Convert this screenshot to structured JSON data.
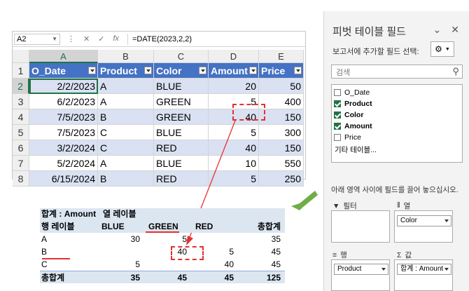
{
  "sheet": {
    "name_box": "A2",
    "formula_icons": [
      "⋮",
      "✕",
      "✓",
      "fx"
    ],
    "formula": "=DATE(2023,2,2)",
    "col_letters": [
      "A",
      "B",
      "C",
      "D",
      "E"
    ],
    "row_numbers": [
      "1",
      "2",
      "3",
      "4",
      "5",
      "6",
      "7",
      "8"
    ],
    "headers": [
      "O_Date",
      "Product",
      "Color",
      "Amount",
      "Price"
    ],
    "rows": [
      [
        "2/2/2023",
        "A",
        "BLUE",
        "20",
        "50"
      ],
      [
        "6/2/2023",
        "A",
        "GREEN",
        "5",
        "400"
      ],
      [
        "7/5/2023",
        "B",
        "GREEN",
        "40",
        "150"
      ],
      [
        "7/5/2023",
        "C",
        "BLUE",
        "5",
        "300"
      ],
      [
        "3/2/2024",
        "C",
        "RED",
        "40",
        "150"
      ],
      [
        "5/2/2024",
        "A",
        "BLUE",
        "10",
        "550"
      ],
      [
        "6/15/2024",
        "B",
        "RED",
        "5",
        "250"
      ]
    ]
  },
  "pivot": {
    "value_label": "합계 : Amount",
    "col_label": "열 레이블",
    "row_label": "행 레이블",
    "columns": [
      "BLUE",
      "GREEN",
      "RED",
      "총합계"
    ],
    "rows": [
      [
        "A",
        "30",
        "5",
        "",
        "35"
      ],
      [
        "B",
        "",
        "40",
        "5",
        "45"
      ],
      [
        "C",
        "5",
        "",
        "40",
        "45"
      ]
    ],
    "total": [
      "총합계",
      "35",
      "45",
      "45",
      "125"
    ]
  },
  "pane": {
    "title": "피벗 테이블 필드",
    "chevron": "⌄",
    "close": "✕",
    "subtitle": "보고서에 추가할 필드 선택:",
    "search_placeholder": "검색",
    "fields": [
      {
        "label": "O_Date",
        "checked": false
      },
      {
        "label": "Product",
        "checked": true
      },
      {
        "label": "Color",
        "checked": true
      },
      {
        "label": "Amount",
        "checked": true
      },
      {
        "label": "Price",
        "checked": false
      }
    ],
    "more_tables": "기타 테이블...",
    "drag_hint": "아래 영역 사이에 필드를 끌어 놓으십시오.",
    "areas": {
      "filter": "필터",
      "columns": "열",
      "rows": "행",
      "values": "값",
      "columns_chip": "Color",
      "rows_chip": "Product",
      "values_chip": "합계 : Amount"
    }
  },
  "colors": {
    "accent": "#217346",
    "header_fill": "#4472c4",
    "band_fill": "#d9e1f2",
    "highlight": "#e53030",
    "arrow": "#70ad47"
  }
}
